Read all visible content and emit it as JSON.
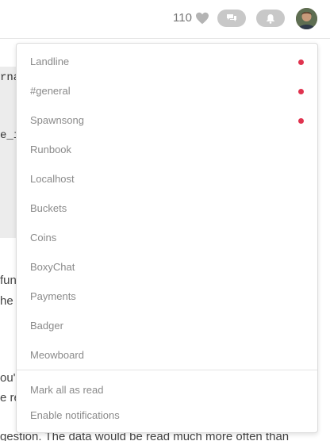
{
  "header": {
    "likes_count": "110",
    "icons": {
      "heart": "heart-icon",
      "chat": "chat-bubbles-icon",
      "notifications": "bell-icon",
      "avatar": "user-avatar"
    }
  },
  "background": {
    "code_lines": [
      "rna",
      "e_i"
    ],
    "text_lines": [
      "func",
      "he r",
      "ou'r",
      "e re",
      "gestion. The data would be read much more often than"
    ]
  },
  "dropdown": {
    "channels": [
      {
        "label": "Landline",
        "unread": true
      },
      {
        "label": "#general",
        "unread": true
      },
      {
        "label": "Spawnsong",
        "unread": true
      },
      {
        "label": "Runbook",
        "unread": false
      },
      {
        "label": "Localhost",
        "unread": false
      },
      {
        "label": "Buckets",
        "unread": false
      },
      {
        "label": "Coins",
        "unread": false
      },
      {
        "label": "BoxyChat",
        "unread": false
      },
      {
        "label": "Payments",
        "unread": false
      },
      {
        "label": "Badger",
        "unread": false
      },
      {
        "label": "Meowboard",
        "unread": false
      }
    ],
    "mark_all_read": "Mark all as read",
    "enable_notifications": "Enable notifications"
  },
  "colors": {
    "unread_dot": "#e0334f",
    "pill_bg": "#c8c8c8",
    "menu_text": "#8a8a8a"
  }
}
